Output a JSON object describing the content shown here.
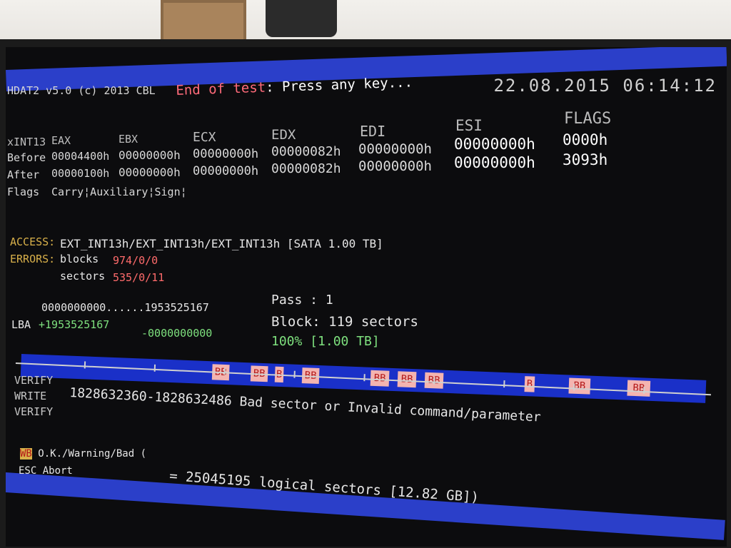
{
  "clock": "22.08.2015 06:14:12",
  "app_name": "HDAT2 v5.0 (c) 2013 CBL",
  "status": {
    "prefix": "End of test",
    "suffix": ": Press any key..."
  },
  "registers": {
    "headers": [
      "xINT13",
      "EAX",
      "EBX",
      "ECX",
      "EDX",
      "EDI",
      "ESI",
      "FLAGS"
    ],
    "before": {
      "label": "Before",
      "values": [
        "00004400h",
        "00000000h",
        "00000000h",
        "00000082h",
        "00000000h",
        "00000000h",
        "0000h"
      ]
    },
    "after": {
      "label": "After",
      "values": [
        "00000100h",
        "00000000h",
        "00000000h",
        "00000082h",
        "00000000h",
        "00000000h",
        "3093h"
      ]
    },
    "flags_label": "Flags",
    "flags_value": "Carry¦Auxiliary¦Sign¦"
  },
  "access": {
    "label": "ACCESS:",
    "value": "EXT_INT13h/EXT_INT13h/EXT_INT13h [SATA 1.00 TB]"
  },
  "errors": {
    "label": "ERRORS:",
    "blocks_label": "blocks",
    "blocks_value": "974/0/0",
    "sectors_label": "sectors",
    "sectors_value": "535/0/11"
  },
  "lba": {
    "range": "0000000000......1953525167",
    "label": "LBA",
    "plus": "+1953525167",
    "minus": "-0000000000"
  },
  "pass": {
    "pass_text": "Pass : 1",
    "block_text": "Block: 119 sectors",
    "progress_text": "100% [1.00 TB]"
  },
  "bar": {
    "bad_blocks": [
      "BB",
      "BB",
      "B",
      "BB",
      "BB",
      "BB",
      "BB",
      "B",
      "BB",
      "BB"
    ]
  },
  "log": {
    "verify1": "VERIFY",
    "write": "WRITE",
    "verify2": "VERIFY",
    "message": "1828632360-1828632486 Bad sector or Invalid command/parameter"
  },
  "legend": {
    "icon_text": "WB",
    "text": "O.K./Warning/Bad (",
    "scale_text": "= 25045195 logical sectors [12.82 GB])"
  },
  "esc_text": "ESC Abort",
  "colors": {
    "blue": "#2b3fc9",
    "bad": "#f4b4b0",
    "green": "#7ee07e",
    "red": "#ff6b6b",
    "yellow": "#d8b04a"
  }
}
